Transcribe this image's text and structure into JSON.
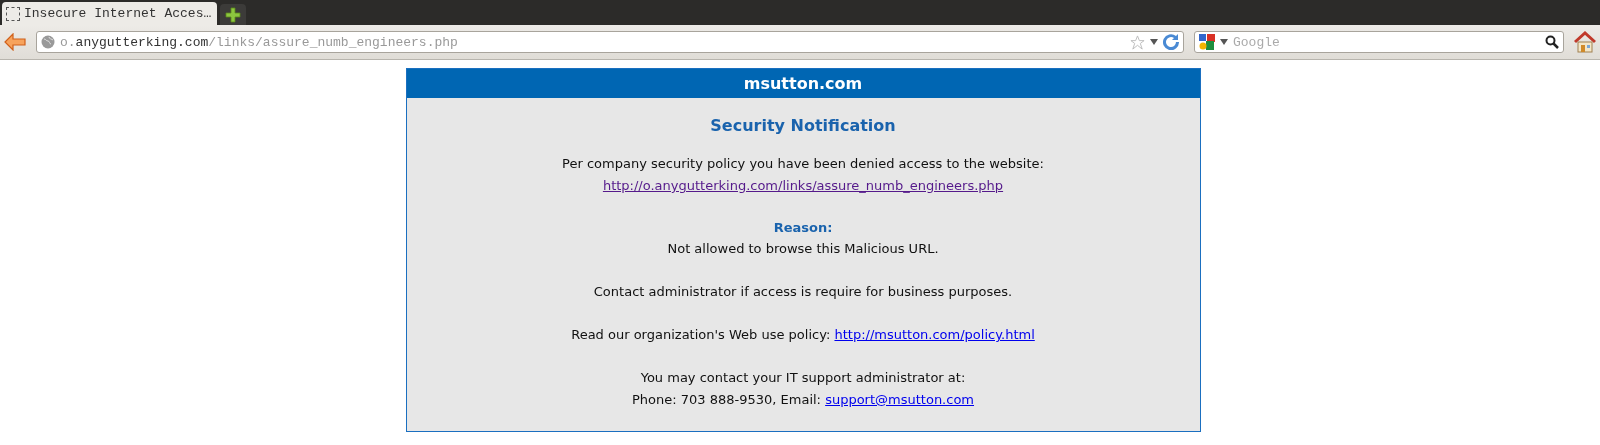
{
  "tabs": [
    {
      "label": "Insecure Internet Acces…",
      "selected": true
    }
  ],
  "toolbar": {
    "address": {
      "subdomain": "o.",
      "domain": "anygutterking.com",
      "path": "/links/assure_numb_engineers.php"
    },
    "search": {
      "placeholder": "Google"
    }
  },
  "notice": {
    "site_title": "msutton.com",
    "heading": "Security Notification",
    "message": "Per company security policy you have been denied access to the website:",
    "blocked_url": "http://o.anygutterking.com/links/assure_numb_engineers.php",
    "reason_label": "Reason:",
    "reason": "Not allowed to browse this Malicious URL.",
    "contact_note": "Contact administrator if access is require for business purposes.",
    "policy_text": "Read our organization's Web use policy:",
    "policy_link": "http://msutton.com/policy.html",
    "support_intro": "You may contact your IT support administrator at:",
    "support_phone": "Phone: 703 888-9530, Email:",
    "support_email": "support@msutton.com"
  }
}
